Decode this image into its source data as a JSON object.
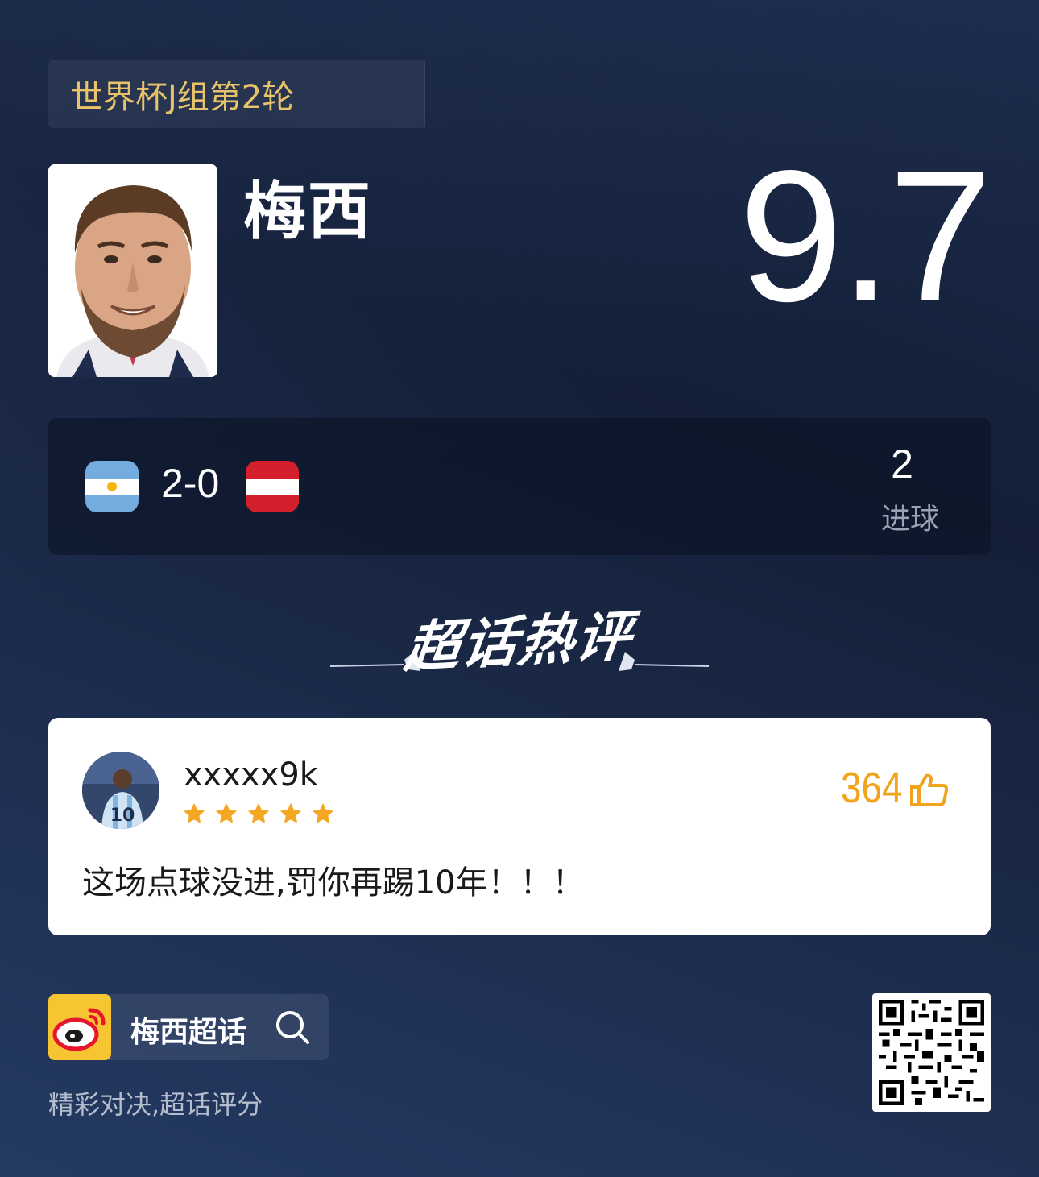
{
  "header": {
    "round_tag": "世界杯J组第2轮"
  },
  "player": {
    "name": "梅西",
    "rating": "9.7",
    "photo_icon": "player-portrait"
  },
  "match": {
    "score": "2-0",
    "home_flag": "argentina-flag-icon",
    "away_flag": "austria-flag-icon",
    "stat_value": "2",
    "stat_label": "进球"
  },
  "section": {
    "title": "超话热评"
  },
  "comment": {
    "username": "xxxxx9k",
    "rating_stars": 5,
    "likes": "364",
    "text": "这场点球没进,罚你再踢10年！！！",
    "colors": {
      "like": "#f2a31c",
      "star": "#f5a623"
    }
  },
  "footer": {
    "super_topic_label": "梅西超话",
    "slogan": "精彩对决,超话评分"
  },
  "colors": {
    "round_tag_text": "#e8c36a",
    "background": "#1b2a49"
  }
}
